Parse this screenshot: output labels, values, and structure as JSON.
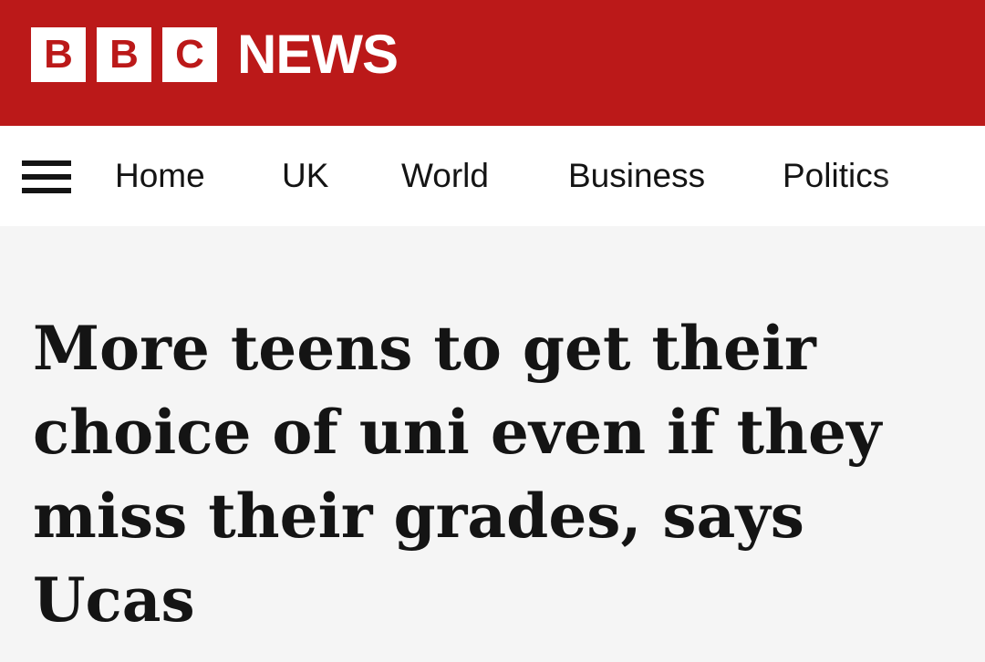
{
  "brand": {
    "blocks": [
      "B",
      "B",
      "C"
    ],
    "news": "NEWS",
    "accent_color": "#bb1919"
  },
  "nav": {
    "menu_icon": "hamburger-menu-icon",
    "items": [
      "Home",
      "UK",
      "World",
      "Business",
      "Politics"
    ]
  },
  "article": {
    "headline": "More teens to get their choice of uni even if they miss their grades, says Ucas"
  }
}
